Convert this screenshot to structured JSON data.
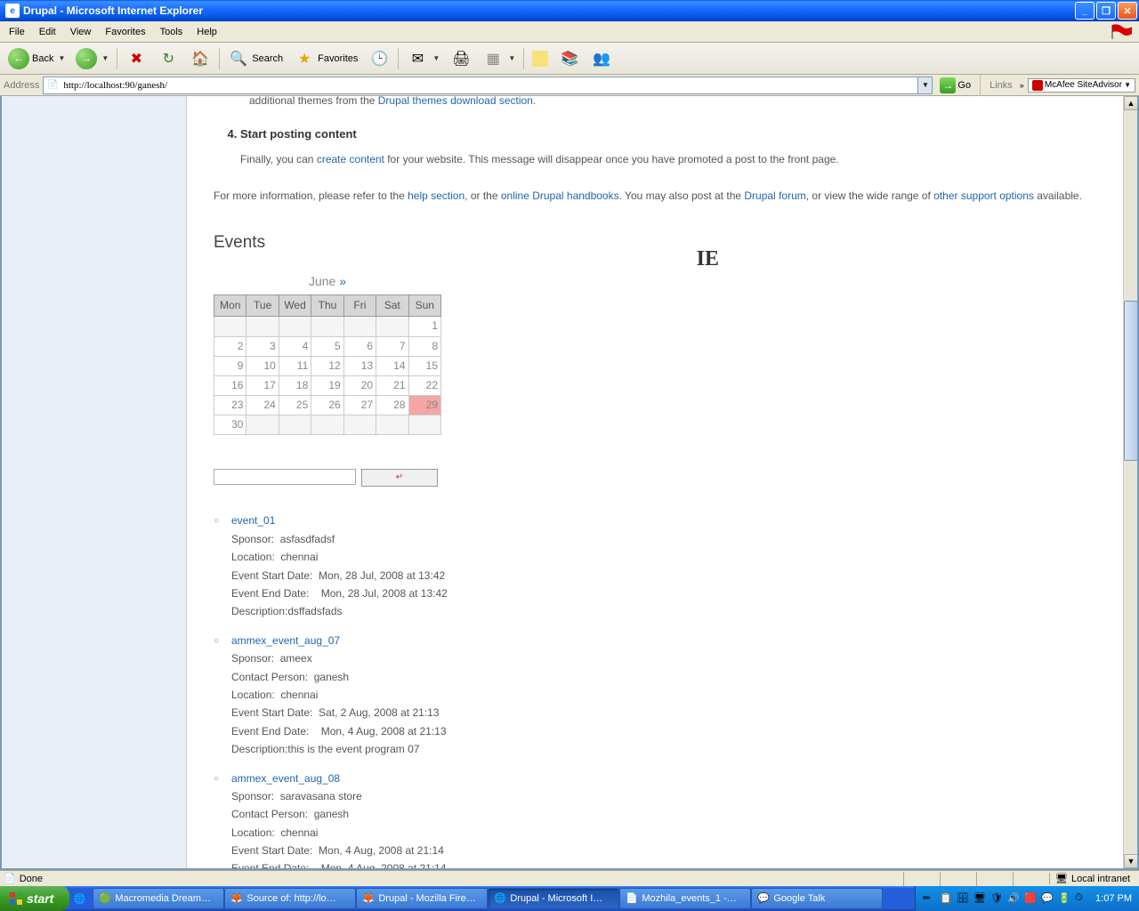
{
  "window": {
    "title": "Drupal - Microsoft Internet Explorer"
  },
  "menu": {
    "file": "File",
    "edit": "Edit",
    "view": "View",
    "favorites": "Favorites",
    "tools": "Tools",
    "help": "Help"
  },
  "toolbar": {
    "back": "Back",
    "search": "Search",
    "favorites": "Favorites"
  },
  "address": {
    "label": "Address",
    "url": "http://localhost:90/ganesh/",
    "go": "Go",
    "links": "Links",
    "mcafee": "McAfee SiteAdvisor"
  },
  "content": {
    "frag_text": "additional themes from the ",
    "frag_link": "Drupal themes download section",
    "step4_title": "Start posting content",
    "step4_pre": "Finally, you can ",
    "step4_link": "create content",
    "step4_post": " for your website. This message will disappear once you have promoted a post to the front page.",
    "footer_1": "For more information, please refer to the ",
    "footer_link1": "help section",
    "footer_2": ", or the ",
    "footer_link2": "online Drupal handbooks",
    "footer_3": ". You may also post at the ",
    "footer_link3": "Drupal forum",
    "footer_4": ", or view the wide range of ",
    "footer_link4": "other support options",
    "footer_5": " available.",
    "events_heading": "Events",
    "ie_mark": "IE"
  },
  "calendar": {
    "month": "June",
    "nav": "»",
    "days": [
      "Mon",
      "Tue",
      "Wed",
      "Thu",
      "Fri",
      "Sat",
      "Sun"
    ],
    "weeks": [
      [
        "",
        "",
        "",
        "",
        "",
        "",
        "1"
      ],
      [
        "2",
        "3",
        "4",
        "5",
        "6",
        "7",
        "8"
      ],
      [
        "9",
        "10",
        "11",
        "12",
        "13",
        "14",
        "15"
      ],
      [
        "16",
        "17",
        "18",
        "19",
        "20",
        "21",
        "22"
      ],
      [
        "23",
        "24",
        "25",
        "26",
        "27",
        "28",
        "29"
      ],
      [
        "30",
        "",
        "",
        "",
        "",
        "",
        ""
      ]
    ],
    "today_row": 4,
    "today_col": 6
  },
  "labels": {
    "sponsor": "Sponsor:",
    "contact": "Contact Person:",
    "location": "Location:",
    "start": "Event Start Date:",
    "end": "Event End Date:",
    "desc": "Description:"
  },
  "events": [
    {
      "title": "event_01",
      "sponsor": "asfasdfadsf",
      "contact": "",
      "location": "chennai",
      "start": "Mon, 28 Jul, 2008 at 13:42",
      "end": "Mon, 28 Jul, 2008 at 13:42",
      "desc": "dsffadsfads"
    },
    {
      "title": "ammex_event_aug_07",
      "sponsor": "ameex",
      "contact": "ganesh",
      "location": "chennai",
      "start": "Sat, 2 Aug, 2008 at 21:13",
      "end": "Mon, 4 Aug, 2008 at 21:13",
      "desc": "this is the event program 07"
    },
    {
      "title": "ammex_event_aug_08",
      "sponsor": "saravasana store",
      "contact": "ganesh",
      "location": "chennai",
      "start": "Mon, 4 Aug, 2008 at 21:14",
      "end": "Mon, 4 Aug, 2008 at 21:14",
      "desc": ""
    }
  ],
  "status": {
    "text": "Done",
    "zone": "Local intranet"
  },
  "taskbar": {
    "start": "start",
    "items": [
      "Macromedia Dream…",
      "Source of: http://lo…",
      "Drupal - Mozilla Fire…",
      "Drupal - Microsoft I…",
      "Mozhila_events_1 -…",
      "Google Talk"
    ],
    "active_index": 3,
    "time": "1:07 PM"
  }
}
